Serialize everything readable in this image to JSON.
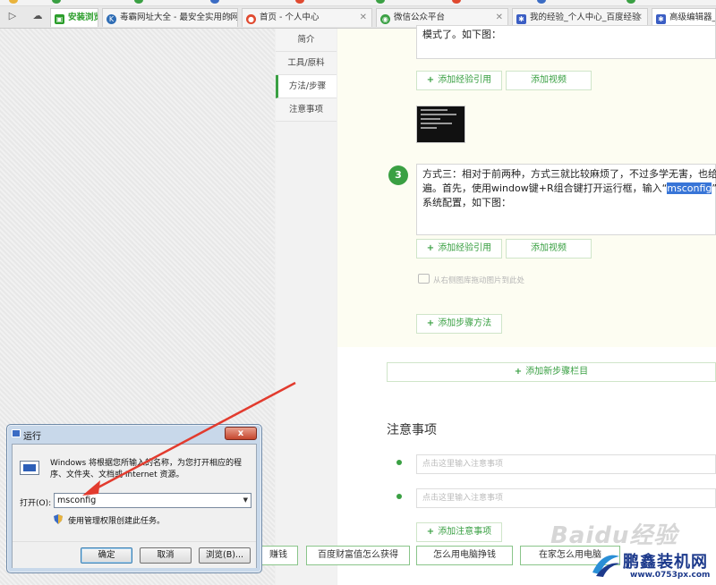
{
  "browser": {
    "tabs": [
      {
        "label": "安装浏览",
        "icon": "hao-icon",
        "color": "#2a9d2a",
        "style": "green"
      },
      {
        "label": "毒霸网址大全 - 最安全实用的网",
        "icon": "k-icon",
        "color": "#2f6db5"
      },
      {
        "label": "首页 - 个人中心",
        "icon": "weibo-icon",
        "color": "#e0492f"
      },
      {
        "label": "微信公众平台",
        "icon": "wechat-icon",
        "color": "#3aa043"
      },
      {
        "label": "我的经验_个人中心_百度经验",
        "icon": "paw-icon",
        "color": "#3b5ec4"
      },
      {
        "label": "高级编辑器_百度",
        "icon": "paw-icon",
        "color": "#3b5ec4",
        "style": "active"
      }
    ],
    "close_glyph": "✕"
  },
  "sidenav": {
    "items": [
      "简介",
      "工具/原料",
      "方法/步骤",
      "注意事项"
    ]
  },
  "editor": {
    "step2_tail": "模式了。如下图：",
    "add_quote": "添加经验引用",
    "add_video": "添加视频",
    "step3_num": "3",
    "step3_text_a": "方式三：相对于前两种，方式三就比较麻烦了，不过多学无害，也给",
    "step3_text_b1": "遍。首先，使用window键+R组合键打开运行框，输入“",
    "step3_text_b_hl": "msconfig",
    "step3_text_b2": "”",
    "step3_text_c": "系统配置，如下图：",
    "drag_hint": "从右侧图库拖动图片到此处",
    "add_method": "添加步骤方法",
    "add_section": "添加新步骤栏目",
    "plus": "+"
  },
  "notes": {
    "title": "注意事项",
    "placeholder": "点击这里输入注意事项",
    "add_note": "添加注意事项"
  },
  "bottom_links": [
    "赚钱",
    "百度财富值怎么获得",
    "怎么用电脑挣钱",
    "在家怎么用电脑"
  ],
  "watermarks": {
    "baidu": "Baidu经验",
    "site_name": "鹏鑫装机网",
    "site_url": "www.0753px.com"
  },
  "run_dialog": {
    "title": "运行",
    "close": "x",
    "description": "Windows 将根据您所输入的名称，为您打开相应的程序、文件夹、文档或 Internet 资源。",
    "open_label": "打开(O):",
    "open_value": "msconfig",
    "admin_text": "使用管理权限创建此任务。",
    "ok": "确定",
    "cancel": "取消",
    "browse": "浏览(B)..."
  },
  "colors": {
    "accent_green": "#3aa043",
    "arrow_red": "#e23b2e",
    "selection_blue": "#3875d7"
  }
}
